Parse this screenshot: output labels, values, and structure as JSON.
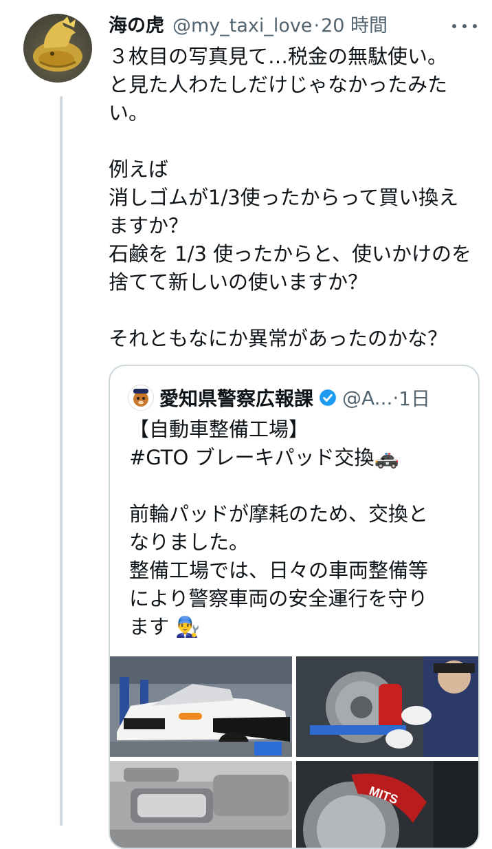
{
  "tweet": {
    "author_name": "海の虎",
    "handle": "@my_taxi_love",
    "separator": "·",
    "time": "20 時間",
    "text": "３枚目の写真見て…税金の無駄使い。\nと見た人わたしだけじゃなかったみた\nい。\n\n例えば\n消しゴムが1/3使ったからって買い換え\nますか？\n石鹸を 1/3 使ったからと、使いかけのを\n捨てて新しいの使いますか？\n\nそれともなにか異常があったのかな？",
    "avatar_icon": "golden-shachihoko-avatar",
    "more_icon": "more-options-icon"
  },
  "quote": {
    "author_name": "愛知県警察広報課",
    "handle": "@A...",
    "separator": "·",
    "time": "1日",
    "verified_color": "#1d9bf0",
    "text": "【自動車整備工場】\n#GTO ブレーキパッド交換🚓\n\n前輪パッドが摩耗のため、交換と\nなりました。\n整備工場では、日々の車両整備等\nにより警察車両の安全運行を守り\nます 👨‍🔧",
    "photos": [
      "police-gto-car-photo",
      "brake-rotor-mechanic-photo",
      "brake-pads-photo",
      "brake-caliper-photo"
    ]
  },
  "colors": {
    "text_primary": "#0f1419",
    "text_secondary": "#536471",
    "border": "#cfd9de"
  }
}
